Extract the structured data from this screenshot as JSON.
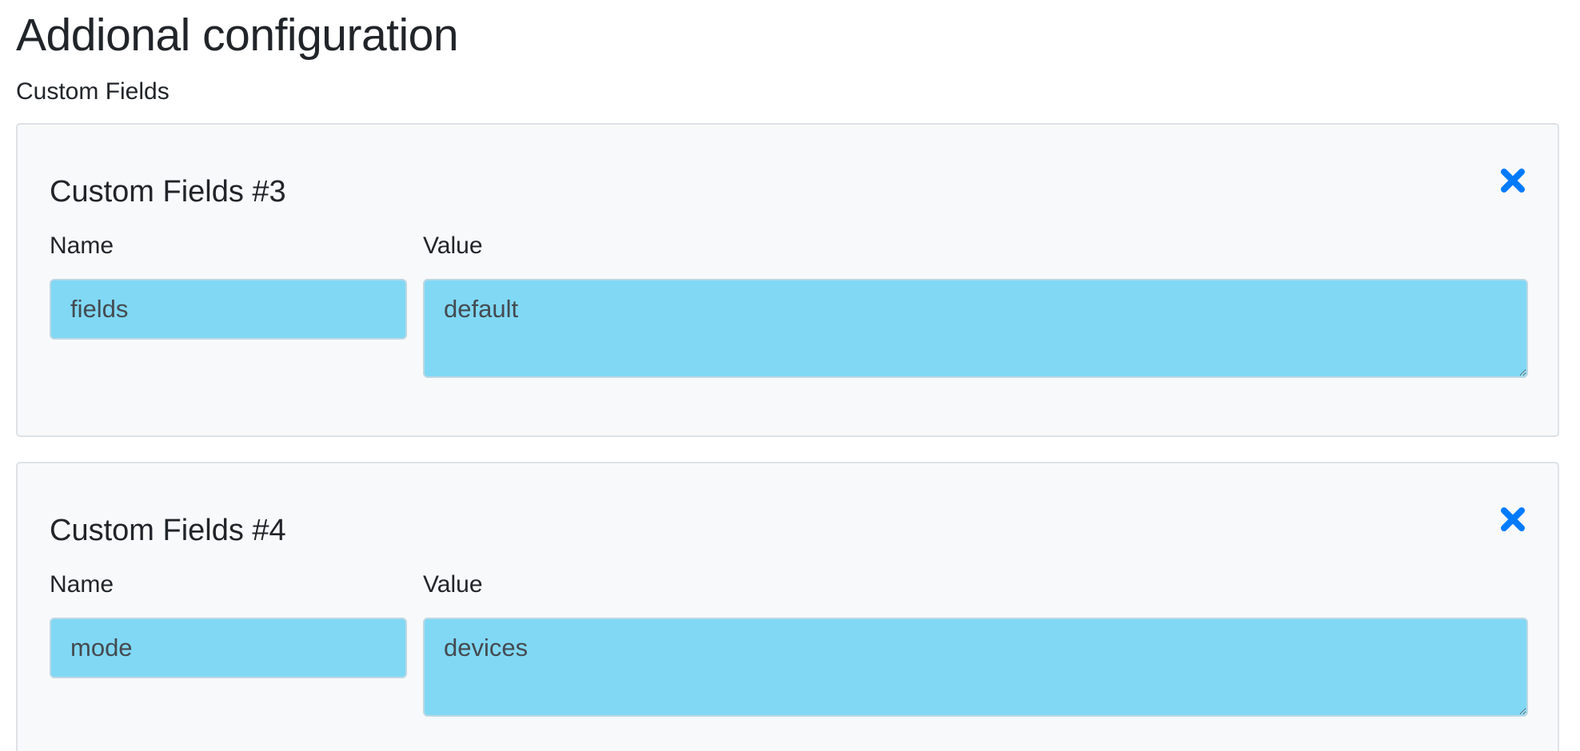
{
  "page": {
    "title": "Addional configuration",
    "section_label": "Custom Fields"
  },
  "colors": {
    "accent": "#007bff",
    "field_background": "#80d8f4",
    "card_background": "#f8f9fa"
  },
  "custom_fields": [
    {
      "title": "Custom Fields #3",
      "name_label": "Name",
      "value_label": "Value",
      "name_value": "fields",
      "value_value": "default",
      "remove_icon": "close-icon"
    },
    {
      "title": "Custom Fields #4",
      "name_label": "Name",
      "value_label": "Value",
      "name_value": "mode",
      "value_value": "devices",
      "remove_icon": "close-icon"
    }
  ]
}
